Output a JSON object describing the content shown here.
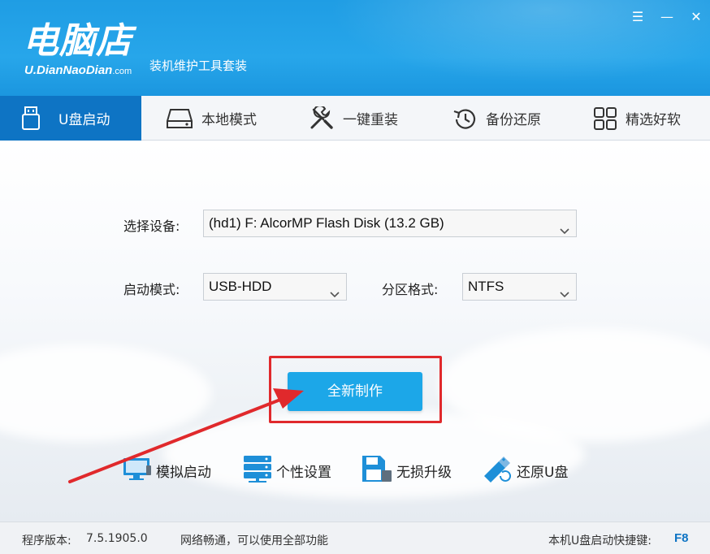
{
  "header": {
    "logo_main": "电脑店",
    "logo_url": "U.DianNaoDian",
    "logo_url_suffix": ".com",
    "tagline": "装机维护工具套装",
    "window_controls": {
      "menu": "☰",
      "minimize": "—",
      "close": "✕"
    }
  },
  "nav": {
    "items": [
      {
        "label": "U盘启动",
        "icon": "usb-drive-icon",
        "active": true
      },
      {
        "label": "本地模式",
        "icon": "hard-disk-icon",
        "active": false
      },
      {
        "label": "一键重装",
        "icon": "tools-icon",
        "active": false
      },
      {
        "label": "备份还原",
        "icon": "restore-clock-icon",
        "active": false
      },
      {
        "label": "精选好软",
        "icon": "apps-grid-icon",
        "active": false
      }
    ]
  },
  "form": {
    "device_label": "选择设备:",
    "device_value": "(hd1) F: AlcorMP Flash Disk (13.2 GB)",
    "boot_mode_label": "启动模式:",
    "boot_mode_value": "USB-HDD",
    "partition_label": "分区格式:",
    "partition_value": "NTFS",
    "create_button": "全新制作"
  },
  "tools": [
    {
      "label": "模拟启动",
      "icon": "monitor-icon"
    },
    {
      "label": "个性设置",
      "icon": "server-settings-icon"
    },
    {
      "label": "无损升级",
      "icon": "save-disk-icon"
    },
    {
      "label": "还原U盘",
      "icon": "usb-restore-icon"
    }
  ],
  "status": {
    "version_label": "程序版本:",
    "version_value": "7.5.1905.0",
    "network": "网络畅通，可以使用全部功能",
    "hotkey_label": "本机U盘启动快捷键:",
    "hotkey_value": "F8"
  },
  "colors": {
    "header_blue": "#1f9de4",
    "nav_active": "#0e74c4",
    "primary_button": "#1ca7e8",
    "highlight_red": "#e0292c",
    "icon_blue": "#1e8fd8"
  }
}
